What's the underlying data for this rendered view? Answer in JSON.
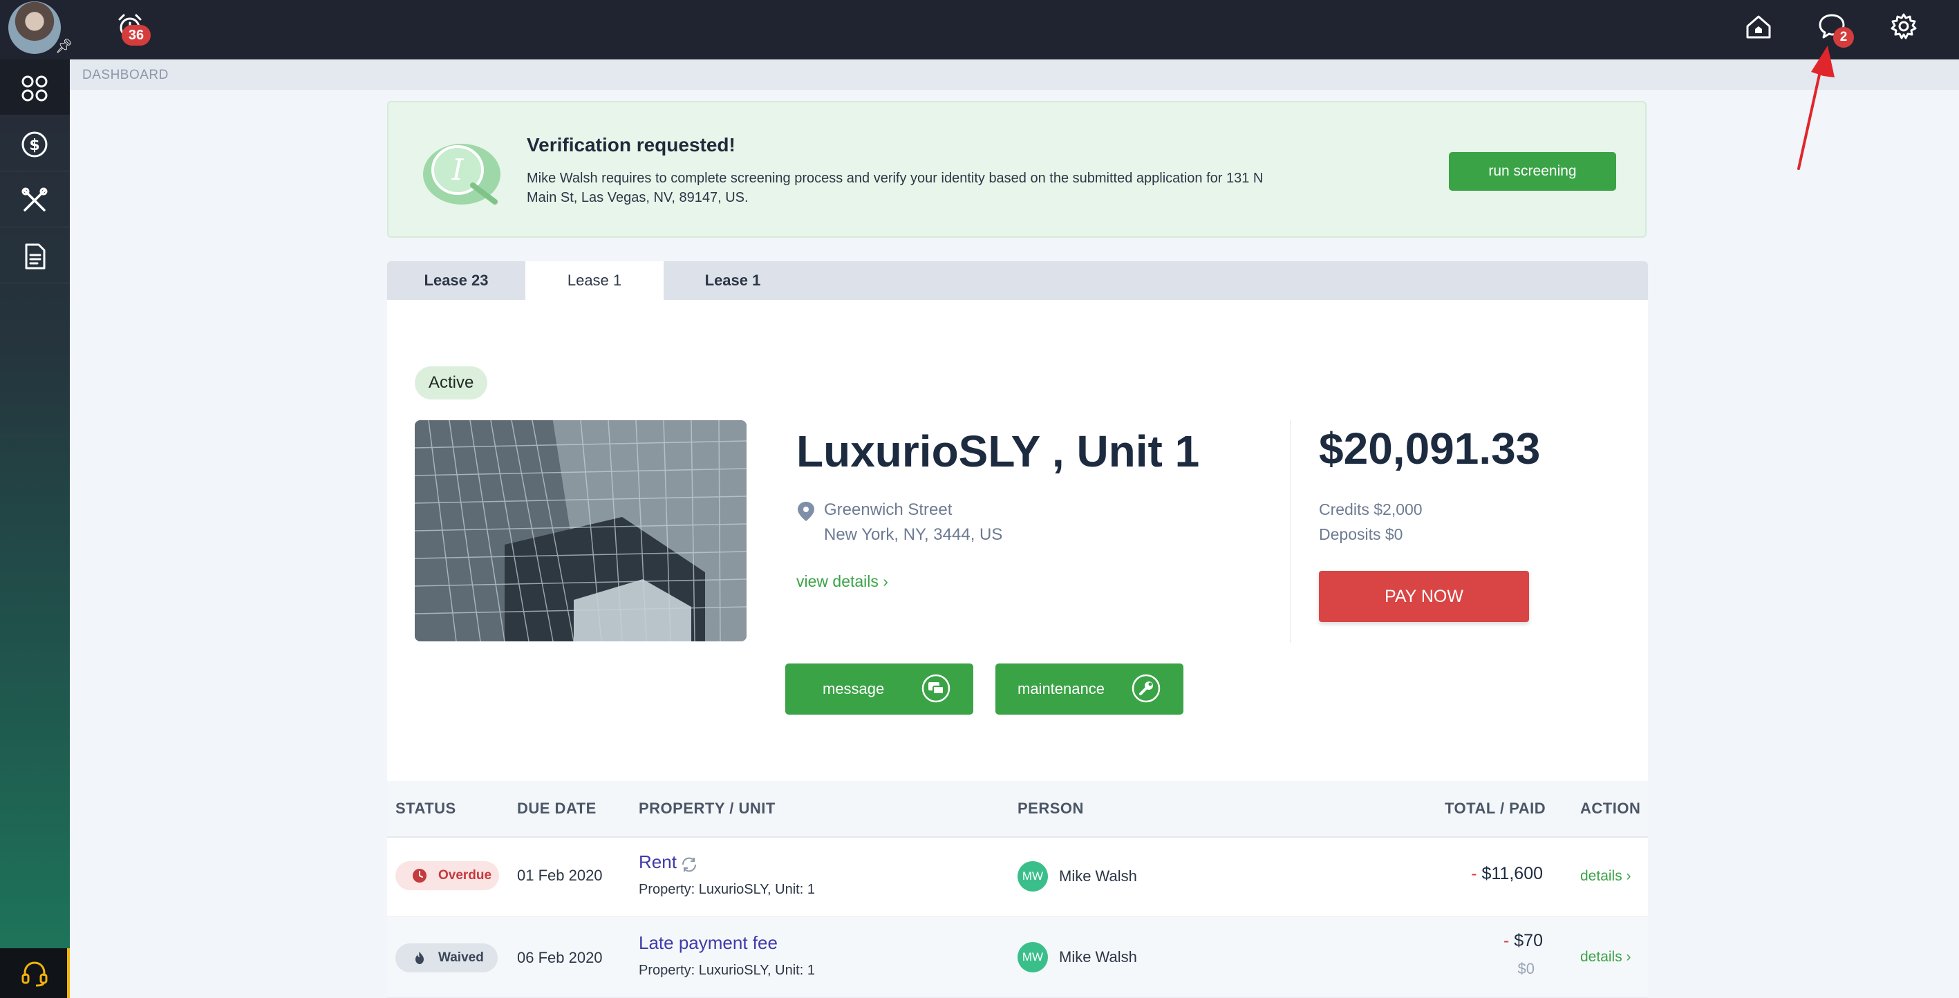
{
  "topbar": {
    "alarm_badge": "36",
    "messages_badge": "2",
    "icons": [
      "user-avatar",
      "alarm-clock-icon",
      "home-icon",
      "chat-bubble-icon",
      "gear-icon"
    ]
  },
  "sidebar": {
    "items": [
      "dashboard-grid-icon",
      "dollar-circle-icon",
      "tools-icon",
      "document-icon"
    ],
    "support_icon": "headset-icon"
  },
  "breadcrumb": "DASHBOARD",
  "banner": {
    "title": "Verification requested!",
    "text": "Mike Walsh requires to complete screening process and verify your identity based on the submitted application for 131 N Main St, Las Vegas, NV, 89147, US.",
    "button": "run screening"
  },
  "tabs": [
    {
      "label": "Lease 23",
      "active": false
    },
    {
      "label": "Lease 1",
      "active": true
    },
    {
      "label": "Lease 1",
      "active": false
    }
  ],
  "lease": {
    "status": "Active",
    "title": "LuxurioSLY , Unit 1",
    "address_line1": "Greenwich Street",
    "address_line2": "New York, NY, 3444, US",
    "view_details": "view details ›",
    "amount": "$20,091.33",
    "credits": "Credits $2,000",
    "deposits": "Deposits $0",
    "pay_button": "PAY NOW",
    "message_button": "message",
    "maintenance_button": "maintenance"
  },
  "table": {
    "headers": [
      "STATUS",
      "DUE DATE",
      "PROPERTY / UNIT",
      "PERSON",
      "TOTAL / PAID",
      "ACTION"
    ],
    "rows": [
      {
        "status": "Overdue",
        "due_date": "01 Feb 2020",
        "title": "Rent",
        "property": "Property: LuxurioSLY, Unit: 1",
        "initials": "MW",
        "person": "Mike Walsh",
        "total": "$11,600",
        "paid": "",
        "action": "details ›"
      },
      {
        "status": "Waived",
        "due_date": "06 Feb 2020",
        "title": "Late payment fee",
        "property": "Property: LuxurioSLY, Unit: 1",
        "initials": "MW",
        "person": "Mike Walsh",
        "total": "$70",
        "paid": "$0",
        "action": "details ›"
      }
    ]
  },
  "colors": {
    "topbar": "#1f2430",
    "accent_green": "#3aa346",
    "danger_red": "#d94444",
    "badge_red": "#d53d3d",
    "link_purple": "#3f3ba8",
    "annotation_arrow": "#e0262b"
  }
}
